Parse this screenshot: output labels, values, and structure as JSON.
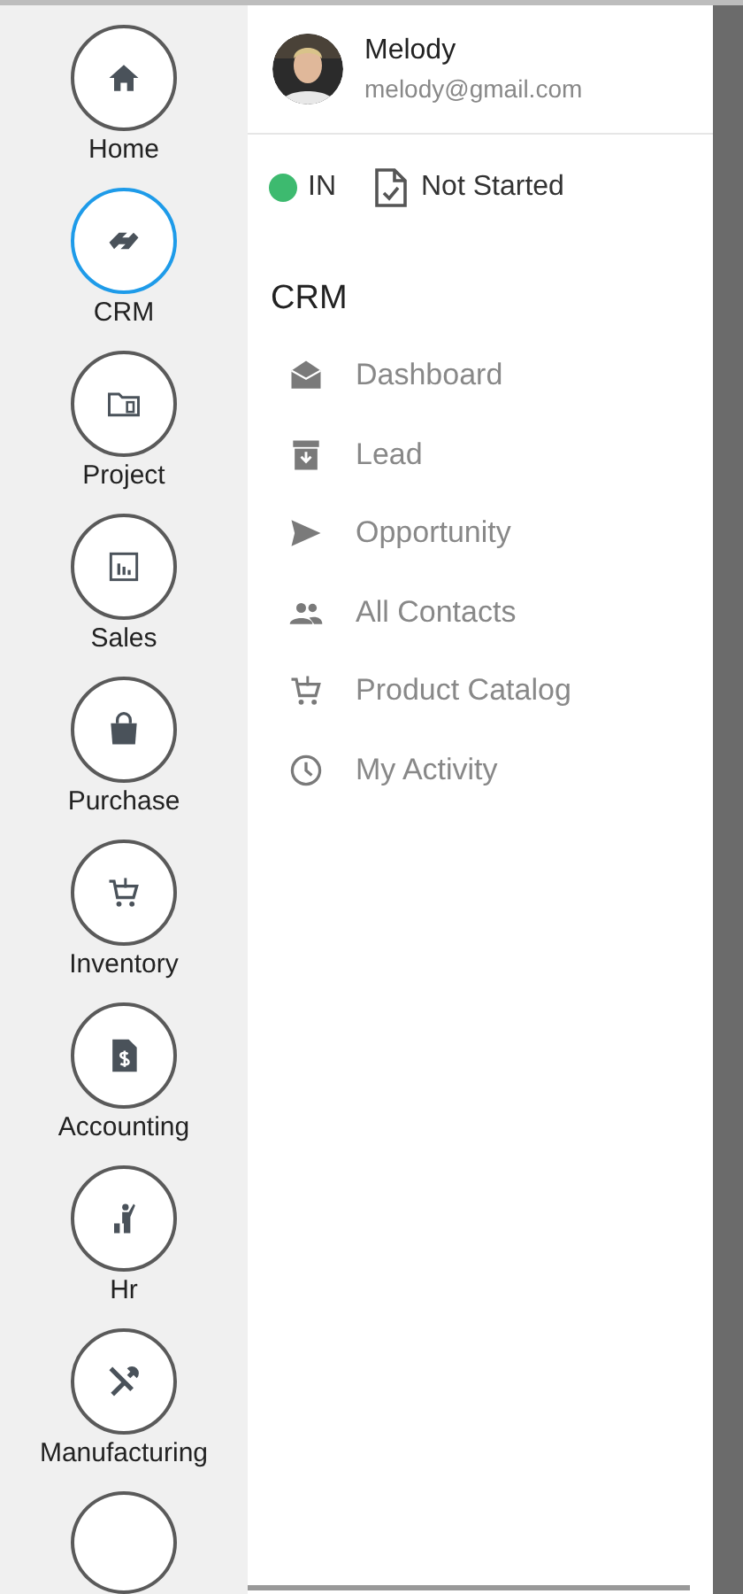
{
  "modules": [
    {
      "label": "Home",
      "kind": "home",
      "selected": false
    },
    {
      "label": "CRM",
      "kind": "handshake",
      "selected": true
    },
    {
      "label": "Project",
      "kind": "folder",
      "selected": false
    },
    {
      "label": "Sales",
      "kind": "chart",
      "selected": false
    },
    {
      "label": "Purchase",
      "kind": "bag",
      "selected": false
    },
    {
      "label": "Inventory",
      "kind": "cart",
      "selected": false
    },
    {
      "label": "Accounting",
      "kind": "invoice",
      "selected": false
    },
    {
      "label": "Hr",
      "kind": "person",
      "selected": false
    },
    {
      "label": "Manufacturing",
      "kind": "tools",
      "selected": false
    }
  ],
  "more_modules_below": true,
  "user": {
    "name": "Melody",
    "email": "melody@gmail.com"
  },
  "attendance": {
    "status": "IN",
    "color": "#3dba6f",
    "task_status": "Not Started"
  },
  "section": {
    "title": "CRM",
    "items": [
      {
        "label": "Dashboard",
        "kind": "mail"
      },
      {
        "label": "Lead",
        "kind": "box"
      },
      {
        "label": "Opportunity",
        "kind": "send"
      },
      {
        "label": "All Contacts",
        "kind": "people"
      },
      {
        "label": "Product Catalog",
        "kind": "cart"
      },
      {
        "label": "My Activity",
        "kind": "clock"
      }
    ]
  }
}
